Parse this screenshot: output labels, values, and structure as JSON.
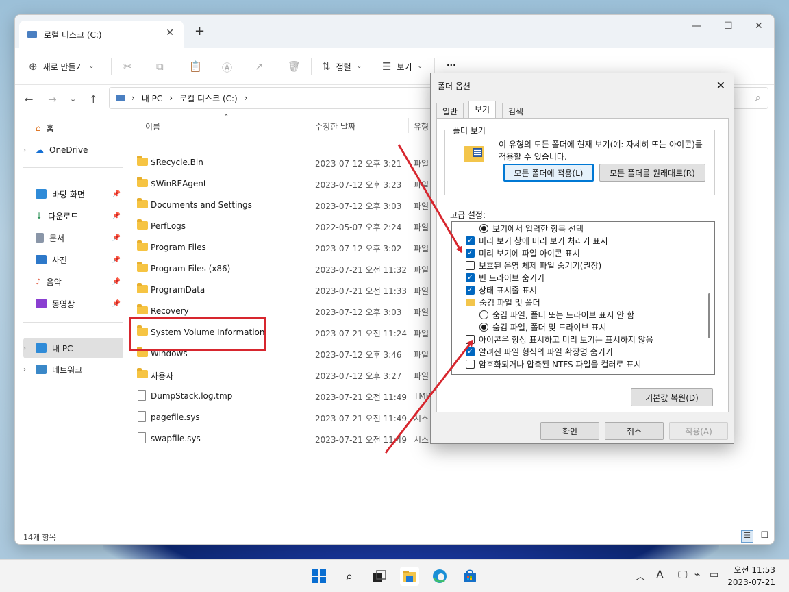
{
  "explorer": {
    "tab_title": "로컬 디스크 (C:)",
    "ribbon": {
      "new_label": "새로 만들기",
      "sort_label": "정렬",
      "view_label": "보기",
      "more_label": "···"
    },
    "address": {
      "crumbs": [
        "내 PC",
        "로컬 디스크 (C:)"
      ]
    },
    "sidebar": {
      "items": [
        {
          "label": "홈"
        },
        {
          "label": "OneDrive"
        },
        {
          "label": "바탕 화면"
        },
        {
          "label": "다운로드"
        },
        {
          "label": "문서"
        },
        {
          "label": "사진"
        },
        {
          "label": "음악"
        },
        {
          "label": "동영상"
        },
        {
          "label": "내 PC"
        },
        {
          "label": "네트워크"
        }
      ]
    },
    "columns": {
      "name": "이름",
      "date": "수정한 날짜",
      "type": "유형"
    },
    "files": [
      {
        "name": "$Recycle.Bin",
        "date": "2023-07-12 오후 3:21",
        "type": "파일"
      },
      {
        "name": "$WinREAgent",
        "date": "2023-07-12 오후 3:23",
        "type": "파일"
      },
      {
        "name": "Documents and Settings",
        "date": "2023-07-12 오후 3:03",
        "type": "파일"
      },
      {
        "name": "PerfLogs",
        "date": "2022-05-07 오후 2:24",
        "type": "파일"
      },
      {
        "name": "Program Files",
        "date": "2023-07-12 오후 3:02",
        "type": "파일"
      },
      {
        "name": "Program Files (x86)",
        "date": "2023-07-21 오전 11:32",
        "type": "파일"
      },
      {
        "name": "ProgramData",
        "date": "2023-07-21 오전 11:33",
        "type": "파일"
      },
      {
        "name": "Recovery",
        "date": "2023-07-12 오후 3:03",
        "type": "파일"
      },
      {
        "name": "System Volume Information",
        "date": "2023-07-21 오전 11:24",
        "type": "파일"
      },
      {
        "name": "Windows",
        "date": "2023-07-12 오후 3:46",
        "type": "파일"
      },
      {
        "name": "사용자",
        "date": "2023-07-12 오후 3:27",
        "type": "파일"
      },
      {
        "name": "DumpStack.log.tmp",
        "date": "2023-07-21 오전 11:49",
        "type": "TMP"
      },
      {
        "name": "pagefile.sys",
        "date": "2023-07-21 오전 11:49",
        "type": "시스"
      },
      {
        "name": "swapfile.sys",
        "date": "2023-07-21 오전 11:49",
        "type": "시스"
      }
    ],
    "status": "14개 항목"
  },
  "dialog": {
    "title": "폴더 옵션",
    "tabs": [
      "일반",
      "보기",
      "검색"
    ],
    "group_legend": "폴더 보기",
    "group_desc": "이 유형의 모든 폴더에 현재 보기(예: 자세히 또는 아이콘)를 적용할 수 있습니다.",
    "apply_all_button": "모든 폴더에 적용(L)",
    "reset_folders_button": "모든 폴더를 원래대로(R)",
    "advanced_label": "고급 설정:",
    "options": [
      {
        "label": "보기에서 입력한 항목 선택",
        "kind": "radio",
        "checked": true
      },
      {
        "label": "미리 보기 창에 미리 보기 처리기 표시",
        "kind": "check",
        "checked": true
      },
      {
        "label": "미리 보기에 파일 아이콘 표시",
        "kind": "check",
        "checked": true
      },
      {
        "label": "보호된 운영 체제 파일 숨기기(권장)",
        "kind": "check",
        "checked": false
      },
      {
        "label": "빈 드라이브 숨기기",
        "kind": "check",
        "checked": true
      },
      {
        "label": "상태 표시줄 표시",
        "kind": "check",
        "checked": true
      },
      {
        "label": "숨김 파일 및 폴더",
        "kind": "folder",
        "checked": false
      },
      {
        "label": "숨김 파일, 폴더 또는 드라이브 표시 안 함",
        "kind": "radio",
        "checked": false
      },
      {
        "label": "숨김 파일, 폴더 및 드라이브 표시",
        "kind": "radio",
        "checked": true
      },
      {
        "label": "아이콘은 항상 표시하고 미리 보기는 표시하지 않음",
        "kind": "check",
        "checked": false
      },
      {
        "label": "알려진 파일 형식의 파일 확장명 숨기기",
        "kind": "check",
        "checked": true
      },
      {
        "label": "암호화되거나 압축된 NTFS 파일을 컬러로 표시",
        "kind": "check",
        "checked": false
      }
    ],
    "restore_defaults_button": "기본값 복원(D)",
    "ok_button": "확인",
    "cancel_button": "취소",
    "apply_button": "적용(A)"
  },
  "taskbar": {
    "time": "오전 11:53",
    "date": "2023-07-21",
    "ime": "A"
  },
  "colors": {
    "highlight_red": "#d7262e",
    "accent_blue": "#0067c0",
    "folder_yellow": "#f6c443"
  }
}
